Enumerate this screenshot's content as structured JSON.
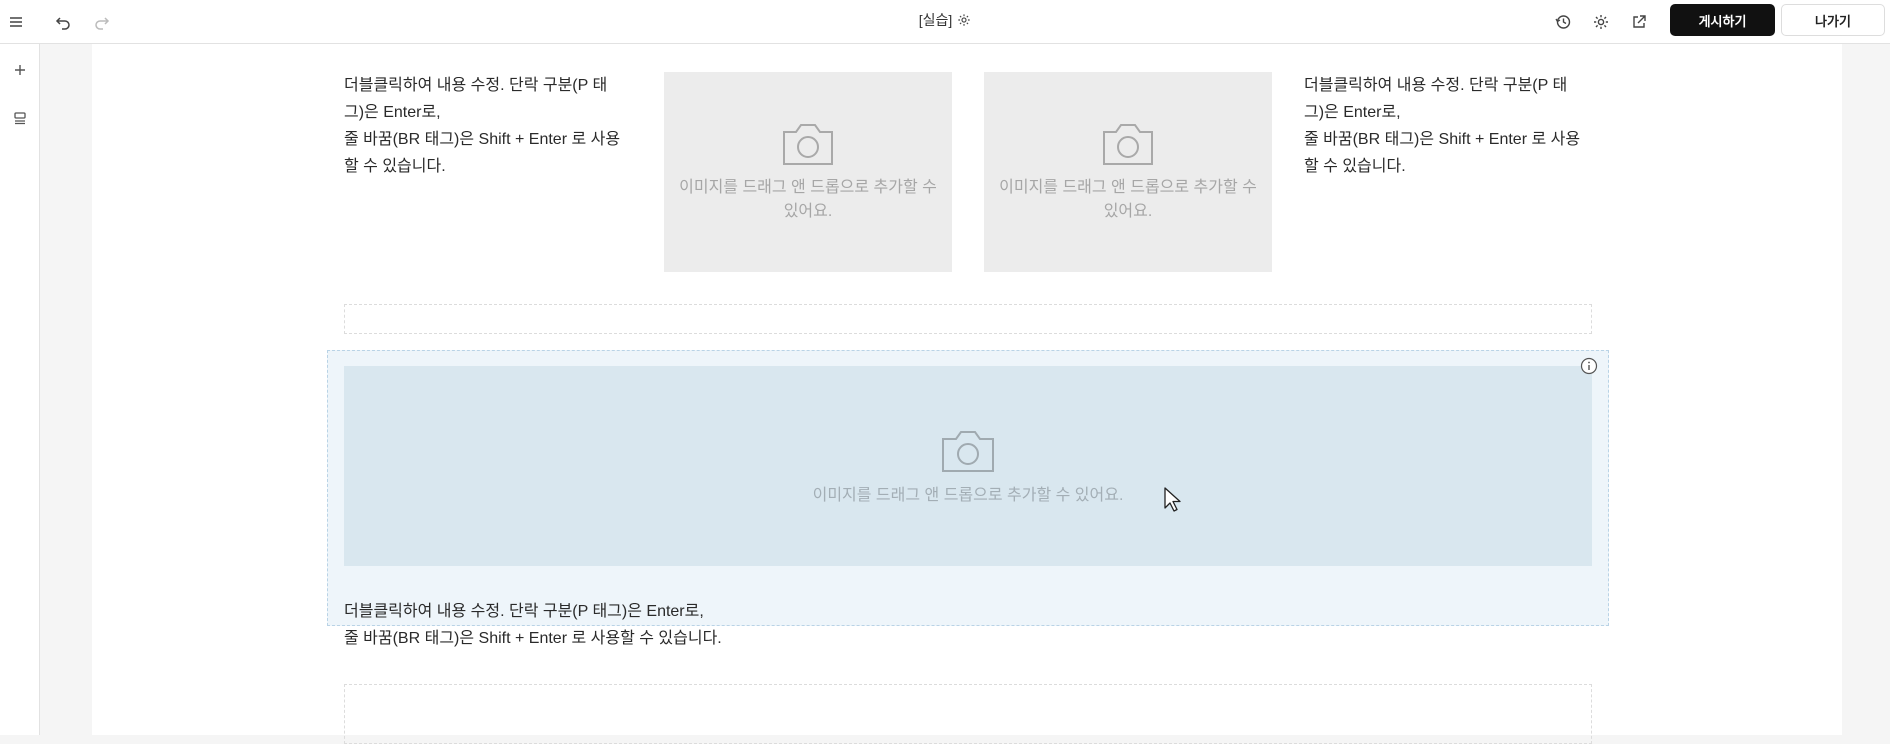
{
  "header": {
    "menu_icon": "hamburger-menu-icon",
    "undo_icon": "undo-icon",
    "redo_icon": "redo-icon",
    "title": "[실습]",
    "title_settings_icon": "gear-icon",
    "history_icon": "history-icon",
    "settings_icon": "gear-icon",
    "preview_icon": "external-link-icon",
    "publish_label": "게시하기",
    "exit_label": "나가기"
  },
  "left_rail": {
    "add_icon": "plus-icon",
    "layers_icon": "layers-icon"
  },
  "blocks": {
    "text_left": {
      "line1": "더블클릭하여 내용 수정. 단락 구분(P 태",
      "line2": "그)은 Enter로,",
      "line3": "줄 바꿈(BR 태그)은 Shift + Enter 로 사용",
      "line4": "할 수 있습니다."
    },
    "image_1": {
      "line1": "이미지를 드래그 앤 드롭으로 추가할 수",
      "line2": "있어요."
    },
    "image_2": {
      "line1": "이미지를 드래그 앤 드롭으로 추가할 수",
      "line2": "있어요."
    },
    "text_right": {
      "line1": "더블클릭하여 내용 수정. 단락 구분(P 태",
      "line2": "그)은 Enter로,",
      "line3": "줄 바꿈(BR 태그)은 Shift + Enter 로 사용",
      "line4": "할 수 있습니다."
    },
    "image_wide": {
      "text": "이미지를 드래그 앤 드롭으로 추가할 수 있어요."
    },
    "text_bottom": {
      "line1": "더블클릭하여 내용 수정. 단락 구분(P 태그)은 Enter로,",
      "line2": "줄 바꿈(BR 태그)은 Shift + Enter 로 사용할 수 있습니다."
    }
  }
}
